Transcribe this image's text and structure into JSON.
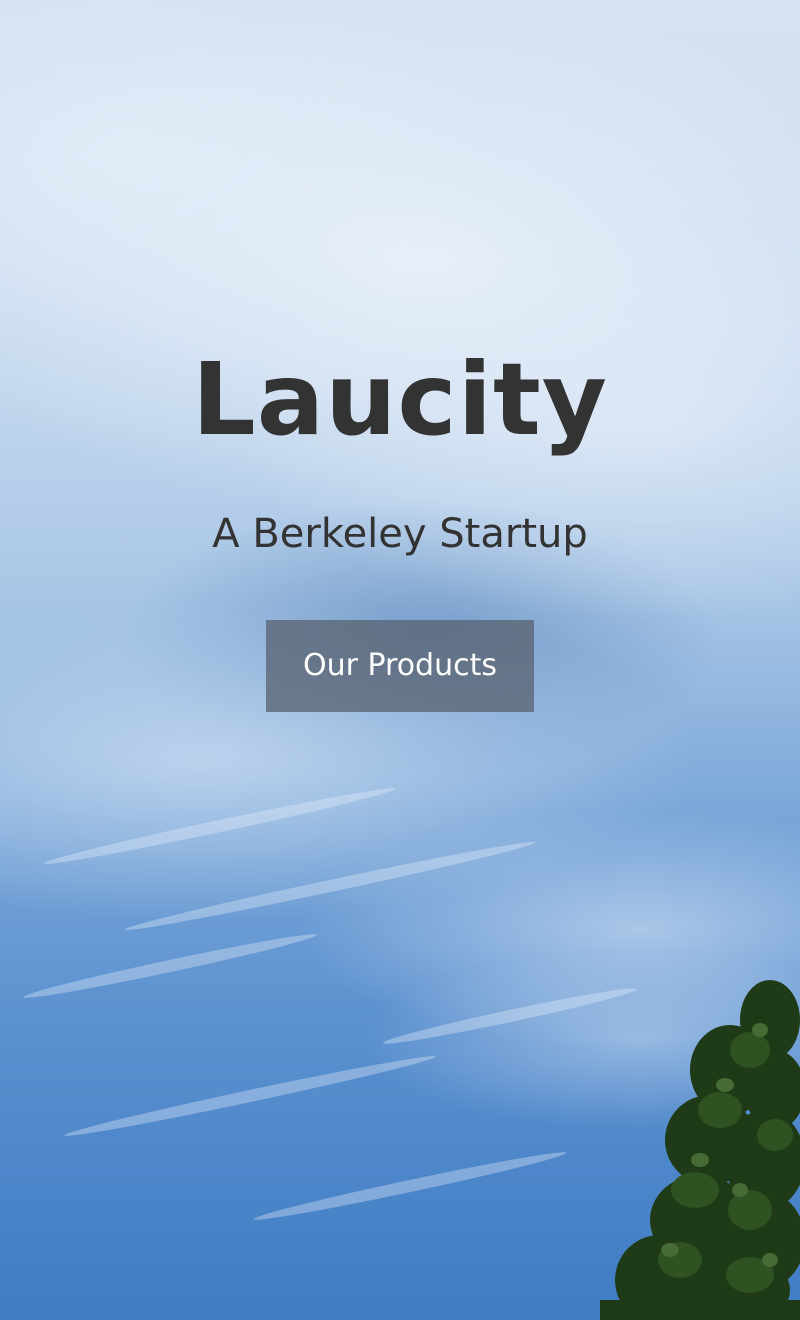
{
  "hero": {
    "title": "Laucity",
    "subtitle": "A Berkeley Startup",
    "cta_label": "Our Products"
  },
  "colors": {
    "text": "#333333",
    "button_bg": "#5a6473",
    "button_text": "#ffffff",
    "sky": "#4a86c8"
  }
}
